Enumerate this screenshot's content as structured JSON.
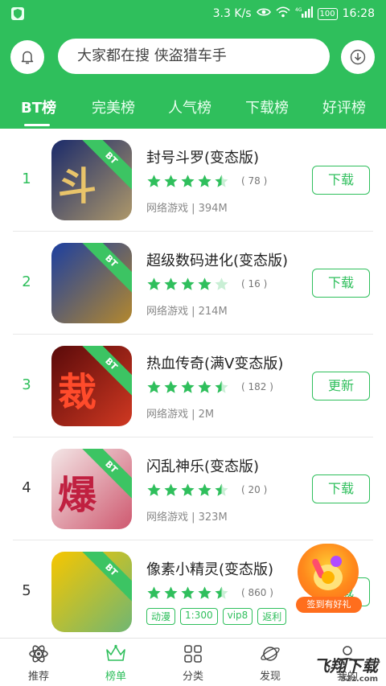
{
  "status_bar": {
    "speed": "3.3 K/s",
    "network": "4G",
    "battery": "100",
    "time": "16:28"
  },
  "header": {
    "search_placeholder": "大家都在搜 侠盗猎车手",
    "tabs": [
      {
        "label": "BT榜",
        "active": true
      },
      {
        "label": "完美榜",
        "active": false
      },
      {
        "label": "人气榜",
        "active": false
      },
      {
        "label": "下载榜",
        "active": false
      },
      {
        "label": "好评榜",
        "active": false
      }
    ]
  },
  "apps": [
    {
      "rank": "1",
      "name": "封号斗罗(变态版)",
      "rating": 4.5,
      "count": "( 78 )",
      "meta": "网络游戏 | 394M",
      "action": "下载",
      "badge": "BT",
      "icon_glyph": "斗罗",
      "icon_color": "#1a2a6a",
      "icon_accent": "#e9c46a",
      "rank_color": "#2fbf5c"
    },
    {
      "rank": "2",
      "name": "超级数码进化(变态版)",
      "rating": 4.0,
      "count": "( 16 )",
      "meta": "网络游戏 | 214M",
      "action": "下载",
      "badge": "BT",
      "icon_glyph": "",
      "icon_color": "#1c3fa0",
      "icon_accent": "#f0a500",
      "rank_color": "#2fbf5c"
    },
    {
      "rank": "3",
      "name": "热血传奇(满V变态版)",
      "rating": 4.5,
      "count": "( 182 )",
      "meta": "网络游戏 | 2M",
      "action": "更新",
      "badge": "BT",
      "icon_glyph": "裁决",
      "icon_color": "#5a0a0a",
      "icon_accent": "#ff4b2b",
      "rank_color": "#2fbf5c"
    },
    {
      "rank": "4",
      "name": "闪乱神乐(变态版)",
      "rating": 4.5,
      "count": "( 20 )",
      "meta": "网络游戏 | 323M",
      "action": "下载",
      "badge": "BT",
      "icon_glyph": "爆",
      "icon_color": "#f3e6e6",
      "icon_accent": "#c02040",
      "rank_color": "#333333"
    },
    {
      "rank": "5",
      "name": "像素小精灵(变态版)",
      "rating": 4.5,
      "count": "( 860 )",
      "tags": [
        "动漫",
        "1:300",
        "vip8",
        "返利"
      ],
      "action": "下载",
      "badge": "BT",
      "icon_glyph": "",
      "icon_color": "#f7c600",
      "icon_accent": "#3ab0a0",
      "rank_color": "#333333"
    }
  ],
  "promo": {
    "label": "签到有好礼"
  },
  "bottom_nav": [
    {
      "label": "推荐",
      "icon": "atom-icon",
      "active": false
    },
    {
      "label": "榜单",
      "icon": "crown-icon",
      "active": true
    },
    {
      "label": "分类",
      "icon": "grid-icon",
      "active": false
    },
    {
      "label": "发现",
      "icon": "planet-icon",
      "active": false
    },
    {
      "label": "我的",
      "icon": "user-icon",
      "active": false
    }
  ],
  "watermark": {
    "text": "飞翔下载",
    "sub": "52z.com"
  },
  "colors": {
    "brand": "#2fbf5c",
    "star": "#2fbf5c",
    "star_empty": "#c9efd5"
  }
}
